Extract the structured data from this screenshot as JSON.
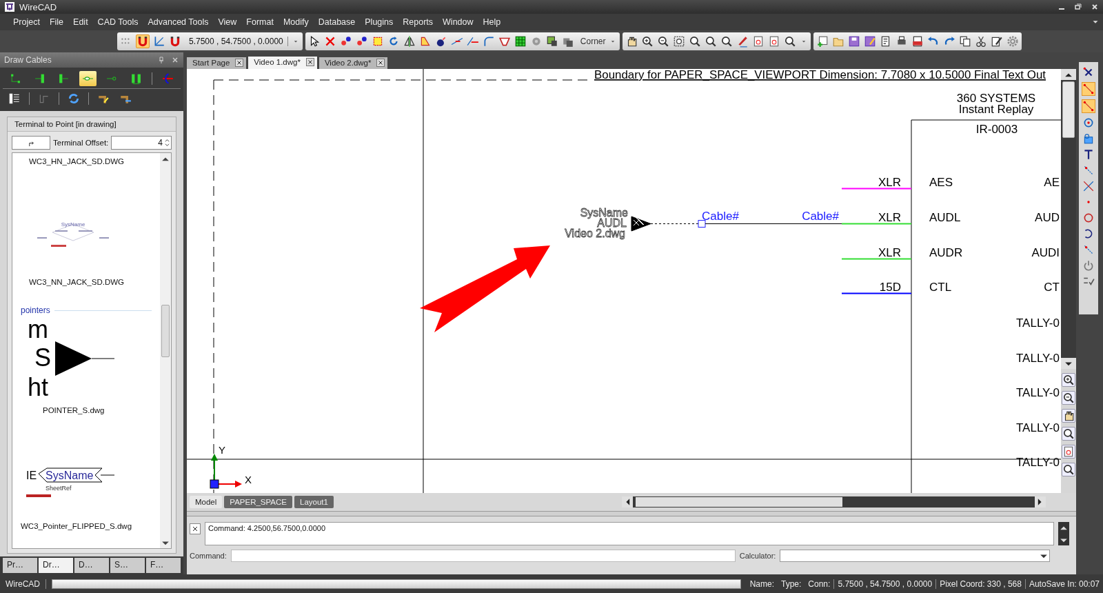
{
  "window": {
    "title": "WireCAD"
  },
  "menu": [
    {
      "label": "Project"
    },
    {
      "label": "File"
    },
    {
      "label": "Edit"
    },
    {
      "label": "CAD Tools"
    },
    {
      "label": "Advanced Tools"
    },
    {
      "label": "View"
    },
    {
      "label": "Format"
    },
    {
      "label": "Modify"
    },
    {
      "label": "Database"
    },
    {
      "label": "Plugins"
    },
    {
      "label": "Reports"
    },
    {
      "label": "Window"
    },
    {
      "label": "Help"
    }
  ],
  "toolbar": {
    "coordinates": "5.7500 , 54.7500 , 0.0000",
    "snap_mode": "Corner"
  },
  "left_panel": {
    "title": "Draw Cables",
    "cable_tools": [
      {
        "selected": false
      },
      {
        "selected": false
      },
      {
        "selected": false
      },
      {
        "selected": true
      },
      {
        "selected": false
      },
      {
        "selected": false
      },
      {
        "selected": false
      }
    ],
    "mode_title": "Terminal to Point [in drawing]",
    "offset_label": "Terminal Offset:",
    "offset_value": "4",
    "entries": [
      {
        "kind": "symbol",
        "file": "WC3_HN_JACK_SD.DWG"
      },
      {
        "kind": "symbol",
        "file": "WC3_NN_JACK_SD.DWG",
        "preview": {
          "kind": "jack",
          "texts": [
            "SysName"
          ]
        }
      },
      {
        "kind": "section",
        "title": "pointers"
      },
      {
        "kind": "symbol",
        "file": "POINTER_S.dwg",
        "preview": {
          "kind": "pointer",
          "texts": [
            "m",
            "S",
            "ht"
          ]
        }
      },
      {
        "kind": "symbol",
        "file": "WC3_Pointer_FLIPPED_S.dwg",
        "preview": {
          "kind": "flipped",
          "texts": [
            "IE",
            "SysName",
            "SheetRef"
          ]
        }
      }
    ],
    "bottom_tabs": [
      {
        "label": "Pr…",
        "selected": false
      },
      {
        "label": "Dr…",
        "selected": true
      },
      {
        "label": "D…",
        "selected": false
      },
      {
        "label": "S…",
        "selected": false
      },
      {
        "label": "F…",
        "selected": false
      }
    ]
  },
  "doc_tabs": [
    {
      "label": "Start Page",
      "selected": false
    },
    {
      "label": "Video 1.dwg*",
      "selected": true
    },
    {
      "label": "Video 2.dwg*",
      "selected": false
    }
  ],
  "drawing": {
    "boundary_text": "Boundary for PAPER_SPACE_VIEWPORT Dimension: 7.7080 x 10.5000 Final Text Out",
    "device": {
      "maker": "360 SYSTEMS",
      "model": "Instant Replay",
      "id": "IR-0003",
      "ports": [
        {
          "connector": "XLR",
          "name": "AES",
          "right_name": "AE",
          "color": "#ff00ff"
        },
        {
          "connector": "XLR",
          "name": "AUDL",
          "right_name": "AUD",
          "color": "#33dd33"
        },
        {
          "connector": "XLR",
          "name": "AUDR",
          "right_name": "AUDI",
          "color": "#33dd33"
        },
        {
          "connector": "15D",
          "name": "CTL",
          "right_name": "CT",
          "color": "#0000ff"
        }
      ],
      "right_labels": [
        "TALLY-0",
        "TALLY-0",
        "TALLY-0",
        "TALLY-0",
        "TALLY-0"
      ]
    },
    "pointer": {
      "lines": [
        "SysName",
        "AUDL",
        "Video 2.dwg"
      ]
    },
    "cable_labels": [
      "Cable#",
      "Cable#"
    ],
    "axis": {
      "y": "Y",
      "x": "X"
    }
  },
  "layout_tabs": [
    {
      "label": "Model",
      "selected": true
    },
    {
      "label": "PAPER_SPACE",
      "selected": false
    },
    {
      "label": "Layout1",
      "selected": false
    }
  ],
  "command": {
    "history": "Command: 4.2500,56.7500,0.0000",
    "prompt_label": "Command:",
    "calculator_label": "Calculator:"
  },
  "status_bar": {
    "app": "WireCAD",
    "progress": {
      "level": 0
    },
    "name": "Name:",
    "type": "Type:",
    "conn": "Conn:",
    "coordinates": "5.7500 , 54.7500 , 0.0000",
    "pixel_coord": "Pixel Coord: 330 , 568",
    "autosave": "AutoSave In: 00:07"
  }
}
